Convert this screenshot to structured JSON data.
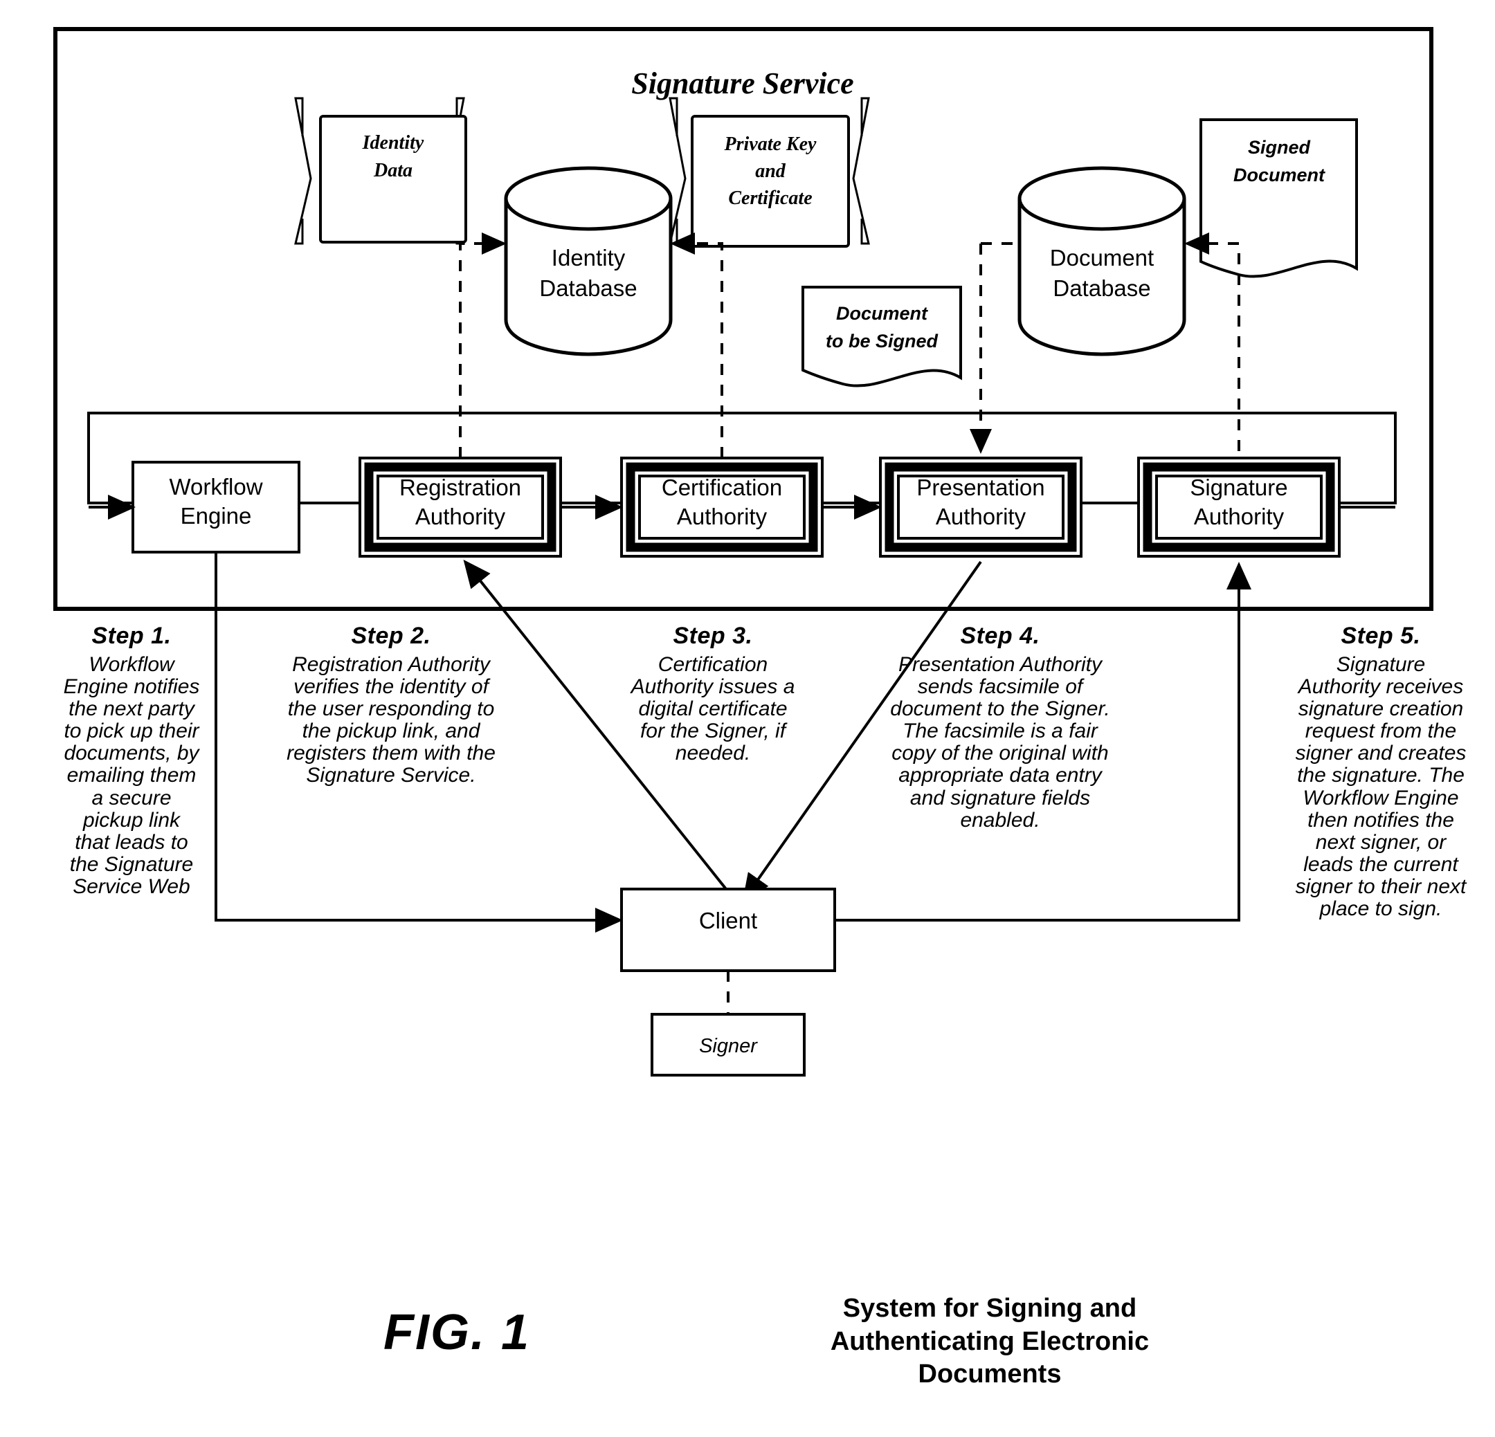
{
  "figure": {
    "number_label": "FIG. 1",
    "caption": "System for Signing and Authenticating Electronic Documents"
  },
  "service_box": {
    "title": "Signature Service"
  },
  "inputs": [
    {
      "name": "identity-data",
      "label_line1": "Identity",
      "label_line2": "Data",
      "shape": "manual-input"
    },
    {
      "name": "private-key-and-certificate",
      "label_line1": "Private Key",
      "label_line2": "and",
      "label_line3": "Certificate",
      "shape": "manual-input"
    },
    {
      "name": "signed-document",
      "label_line1": "Signed",
      "label_line2": "Document",
      "shape": "document"
    },
    {
      "name": "document-to-be-signed",
      "label_line1": "Document",
      "label_line2": "to be Signed",
      "shape": "document"
    }
  ],
  "databases": [
    {
      "name": "identity-database",
      "label_line1": "Identity",
      "label_line2": "Database"
    },
    {
      "name": "document-database",
      "label_line1": "Document",
      "label_line2": "Database"
    }
  ],
  "engines": [
    {
      "name": "workflow-engine",
      "label_line1": "Workflow",
      "label_line2": "Engine",
      "double_border": false
    },
    {
      "name": "registration-authority",
      "label_line1": "Registration",
      "label_line2": "Authority",
      "double_border": true
    },
    {
      "name": "certification-authority",
      "label_line1": "Certification",
      "label_line2": "Authority",
      "double_border": true
    },
    {
      "name": "presentation-authority",
      "label_line1": "Presentation",
      "label_line2": "Authority",
      "double_border": true
    },
    {
      "name": "signature-authority",
      "label_line1": "Signature",
      "label_line2": "Authority",
      "double_border": true
    }
  ],
  "client": {
    "label": "Client"
  },
  "signer": {
    "label": "Signer"
  },
  "steps": [
    {
      "heading": "Step 1.",
      "body": "Workflow\nEngine notifies\nthe next party\nto pick up their\ndocuments, by\nemailing them\na secure\npickup link\nthat leads to\nthe Signature\nService Web"
    },
    {
      "heading": "Step 2.",
      "body": "Registration Authority\nverifies the identity of\nthe user responding to\nthe pickup link, and\nregisters them with the\nSignature Service."
    },
    {
      "heading": "Step 3.",
      "body": "Certification\nAuthority issues a\ndigital certificate\nfor the Signer, if\nneeded."
    },
    {
      "heading": "Step 4.",
      "body": "Presentation Authority\nsends facsimile of\ndocument to the Signer.\nThe facsimile is a fair\ncopy of the original with\nappropriate data entry\nand signature fields\nenabled."
    },
    {
      "heading": "Step 5.",
      "body": "Signature\nAuthority receives\nsignature creation\nrequest from the\nsigner and creates\nthe signature. The\nWorkflow Engine\nthen notifies the\nnext signer, or\nleads the current\nsigner to their next\nplace to sign."
    }
  ],
  "colors": {
    "ink": "#000000",
    "paper": "#ffffff"
  }
}
